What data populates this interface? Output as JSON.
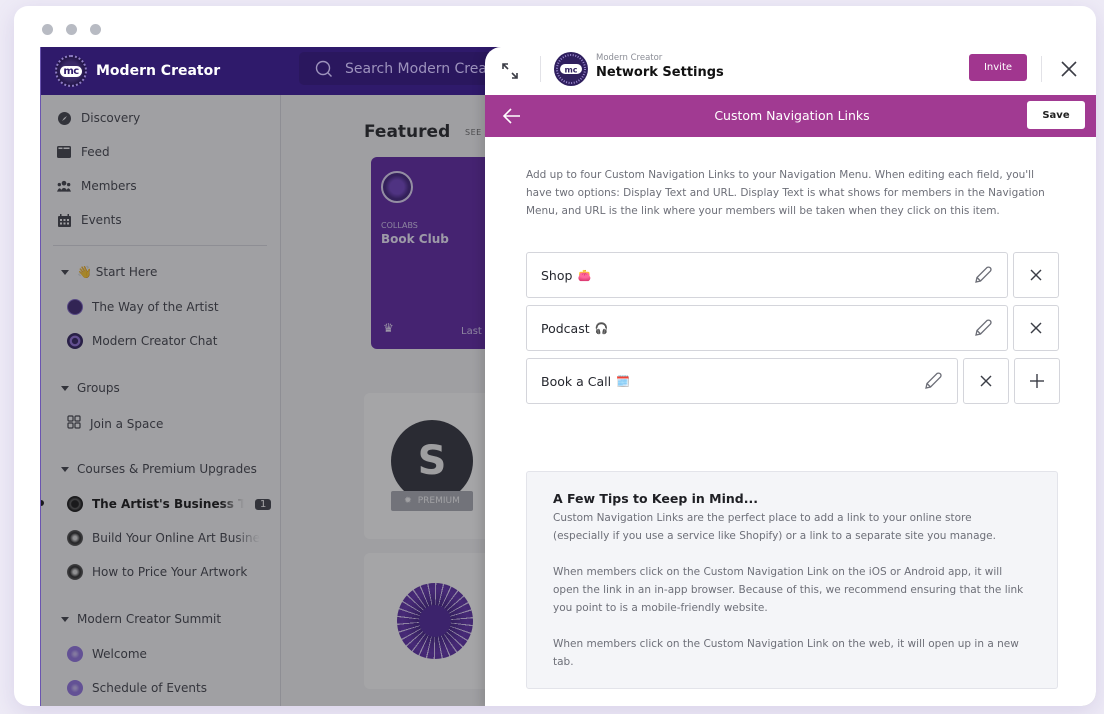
{
  "window": {
    "traffic_lights": [
      "close",
      "minimize",
      "maximize"
    ]
  },
  "app": {
    "brand_name": "Modern Creator",
    "logo_text": "mc",
    "search_placeholder": "Search Modern Creator",
    "sidebar": {
      "main_nav": [
        {
          "label": "Discovery",
          "icon": "compass-icon"
        },
        {
          "label": "Feed",
          "icon": "feed-icon"
        },
        {
          "label": "Members",
          "icon": "members-icon"
        },
        {
          "label": "Events",
          "icon": "calendar-icon"
        }
      ],
      "sections": [
        {
          "label": "👋 Start Here",
          "items": [
            {
              "label": "The Way of the Artist",
              "avatar": "mc"
            },
            {
              "label": "Modern Creator Chat",
              "avatar": "ring"
            }
          ]
        },
        {
          "label": "Groups",
          "items": [
            {
              "label": "Join a Space",
              "icon": "grid-icon"
            }
          ]
        },
        {
          "label": "Courses & Premium Upgrades",
          "items": [
            {
              "label": "The Artist's Business Toolkit",
              "avatar": "dark",
              "active": true,
              "badge": "1"
            },
            {
              "label": "Build Your Online Art Business",
              "avatar": "light"
            },
            {
              "label": "How to Price Your Artwork",
              "avatar": "light"
            }
          ]
        },
        {
          "label": "Modern Creator Summit",
          "items": [
            {
              "label": "Welcome",
              "avatar": "purple"
            },
            {
              "label": "Schedule of Events",
              "avatar": "purple"
            }
          ]
        }
      ]
    },
    "main": {
      "featured_title": "Featured",
      "see_all": "SEE ALL",
      "book_card": {
        "category": "COLLABS",
        "title": "Book Club",
        "footer": "Last A"
      },
      "card_premium": {
        "letter": "S",
        "badge": "PREMIUM"
      }
    }
  },
  "panel": {
    "subtitle": "Modern Creator",
    "title": "Network Settings",
    "invite_label": "Invite",
    "bar_title": "Custom Navigation Links",
    "save_label": "Save",
    "intro": "Add up to four Custom Navigation Links to your Navigation Menu. When editing each field, you'll have two options: Display Text and URL. Display Text is what shows for members in the Navigation Menu, and URL is the link where your members will be taken when they click on this item.",
    "links": [
      {
        "label": "Shop",
        "emoji": "👛"
      },
      {
        "label": "Podcast",
        "emoji": "🎧"
      },
      {
        "label": "Book a Call",
        "emoji": "🗓️"
      }
    ],
    "tips": {
      "title": "A Few Tips to Keep in Mind...",
      "paragraphs": [
        "Custom Navigation Links are the perfect place to add a link to your online store (especially if you use a service like Shopify) or a link to a separate site you manage.",
        "When members click on the Custom Navigation Link on the iOS or Android app, it will open the link in an in-app browser. Because of this, we recommend ensuring that the link you point to is a mobile-friendly website.",
        "When members click on the Custom Navigation Link on the web, it will open up in a new tab."
      ]
    }
  },
  "colors": {
    "brand_dark": "#2f1a6b",
    "accent": "#a13a92",
    "card_purple": "#5a1fa3"
  }
}
